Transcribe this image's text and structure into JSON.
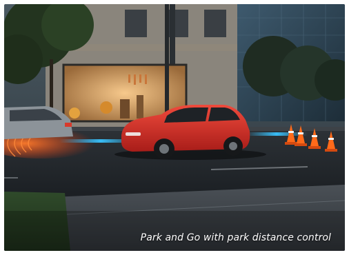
{
  "caption": "Park and Go with park distance control",
  "colors": {
    "car": "#e0302b",
    "sensor_beam": "#39c3ff",
    "warning_glow": "#ff5a1e",
    "shop_light": "#f2b56a"
  },
  "scene": {
    "subject": "red hatchback parking on city street",
    "cones_count": 4
  }
}
